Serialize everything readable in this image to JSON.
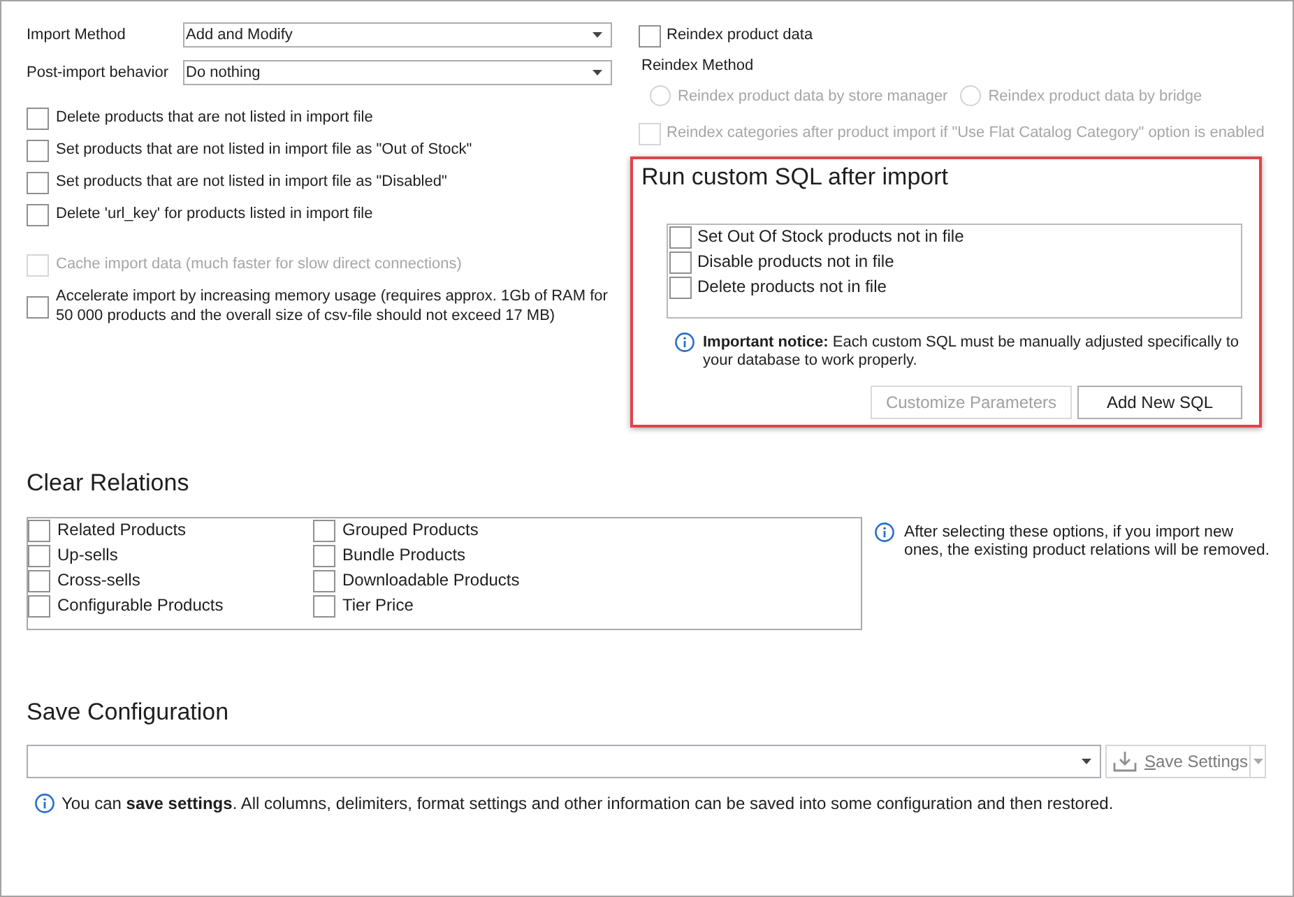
{
  "import": {
    "fields": [
      {
        "label": "Import Method",
        "value": "Add and Modify"
      },
      {
        "label": "Post-import behavior",
        "value": "Do nothing"
      }
    ],
    "options": [
      {
        "label": "Delete products that are not listed in import file",
        "checked": false,
        "disabled": false
      },
      {
        "label": "Set products that are not listed in import file as \"Out of Stock\"",
        "checked": false,
        "disabled": false
      },
      {
        "label": "Set products that are not listed in import file as \"Disabled\"",
        "checked": false,
        "disabled": false
      },
      {
        "label": "Delete 'url_key' for products listed in import file",
        "checked": false,
        "disabled": false
      }
    ],
    "performance_options": [
      {
        "label": "Cache import data (much faster for slow direct connections)",
        "checked": false,
        "disabled": true
      },
      {
        "label": "Accelerate import by increasing memory usage (requires approx. 1Gb of RAM for 50 000 products and the overall size of csv-file should not exceed 17 MB)",
        "checked": false,
        "disabled": false
      }
    ]
  },
  "reindex": {
    "option": {
      "label": "Reindex product data",
      "checked": false,
      "disabled": false
    },
    "method_label": "Reindex Method",
    "methods": [
      {
        "label": "Reindex product data by store manager",
        "selected": false,
        "disabled": true
      },
      {
        "label": "Reindex product data by bridge",
        "selected": false,
        "disabled": true
      }
    ],
    "categories_option": {
      "label": "Reindex categories after product import if \"Use Flat Catalog Category\" option is enabled",
      "checked": false,
      "disabled": true
    }
  },
  "custom_sql": {
    "title": "Run custom SQL after import",
    "highlighted": true,
    "options": [
      {
        "label": "Set Out Of Stock products not in file",
        "checked": false
      },
      {
        "label": "Disable products not in file",
        "checked": false
      },
      {
        "label": "Delete products not in file",
        "checked": false
      }
    ],
    "notice": "**Important notice:** Each custom SQL must be manually adjusted specifically to your database to work properly.",
    "buttons": [
      {
        "label": "Customize Parameters",
        "disabled": true
      },
      {
        "label": "Add New SQL",
        "disabled": false
      }
    ]
  },
  "clear_relations": {
    "title": "Clear Relations",
    "options": [
      {
        "label": "Related Products",
        "checked": false
      },
      {
        "label": "Up-sells",
        "checked": false
      },
      {
        "label": "Cross-sells",
        "checked": false
      },
      {
        "label": "Configurable Products",
        "checked": false
      },
      {
        "label": "Grouped Products",
        "checked": false
      },
      {
        "label": "Bundle Products",
        "checked": false
      },
      {
        "label": "Downloadable Products",
        "checked": false
      },
      {
        "label": "Tier Price",
        "checked": false
      }
    ],
    "notice": "After selecting these options, if you import new ones, the existing product relations will be removed."
  },
  "save_configuration": {
    "title": "Save Configuration",
    "save_button": {
      "label": "Save Settings",
      "disabled": true
    },
    "notice": "You can **save settings**. All columns, delimiters, format settings and other information can be saved into some configuration and then restored."
  }
}
